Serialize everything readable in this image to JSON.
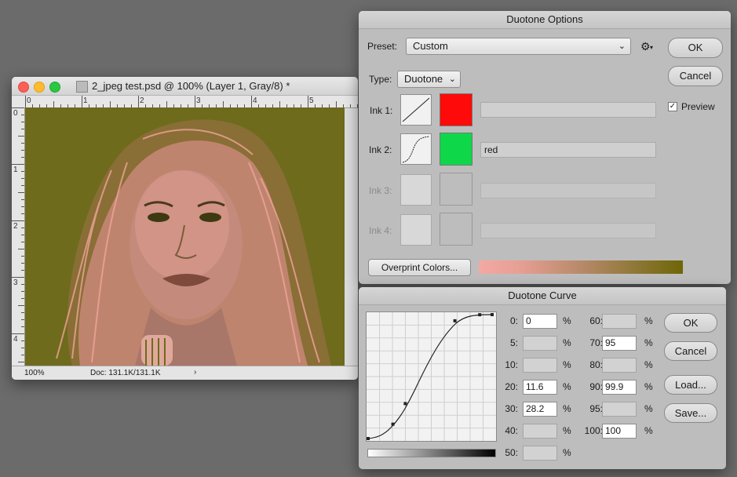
{
  "document_window": {
    "title": "2_jpeg test.psd @ 100% (Layer 1, Gray/8) *",
    "ruler_top": [
      "0",
      "1",
      "2",
      "3",
      "4",
      "5"
    ],
    "ruler_left": [
      "0",
      "1",
      "2",
      "3",
      "4"
    ],
    "zoom": "100%",
    "doc_info": "Doc: 131.1K/131.1K",
    "arrow": "›",
    "colors": {
      "highlight": "#f0a09a",
      "shadow": "#6e6b1c"
    }
  },
  "duotone_options": {
    "title": "Duotone Options",
    "preset_label": "Preset:",
    "preset_value": "Custom",
    "type_label": "Type:",
    "type_value": "Duotone",
    "ok": "OK",
    "cancel": "Cancel",
    "preview_label": "Preview",
    "preview_checked": true,
    "inks": [
      {
        "label": "Ink 1:",
        "name": "",
        "color": "#ff0a0a",
        "enabled": true
      },
      {
        "label": "Ink 2:",
        "name": "red",
        "color": "#0ed84a",
        "enabled": true
      },
      {
        "label": "Ink 3:",
        "name": "",
        "color": "",
        "enabled": false
      },
      {
        "label": "Ink 4:",
        "name": "",
        "color": "",
        "enabled": false
      }
    ],
    "overprint_button": "Overprint Colors..."
  },
  "duotone_curve": {
    "title": "Duotone Curve",
    "ok": "OK",
    "cancel": "Cancel",
    "load": "Load...",
    "save": "Save...",
    "pct": "%",
    "left_column": [
      {
        "label": "0:",
        "value": "0"
      },
      {
        "label": "5:",
        "value": ""
      },
      {
        "label": "10:",
        "value": ""
      },
      {
        "label": "20:",
        "value": "11.6"
      },
      {
        "label": "30:",
        "value": "28.2"
      },
      {
        "label": "40:",
        "value": ""
      },
      {
        "label": "50:",
        "value": ""
      }
    ],
    "right_column": [
      {
        "label": "60:",
        "value": ""
      },
      {
        "label": "70:",
        "value": "95"
      },
      {
        "label": "80:",
        "value": ""
      },
      {
        "label": "90:",
        "value": "99.9"
      },
      {
        "label": "95:",
        "value": ""
      },
      {
        "label": "100:",
        "value": "100"
      }
    ]
  }
}
